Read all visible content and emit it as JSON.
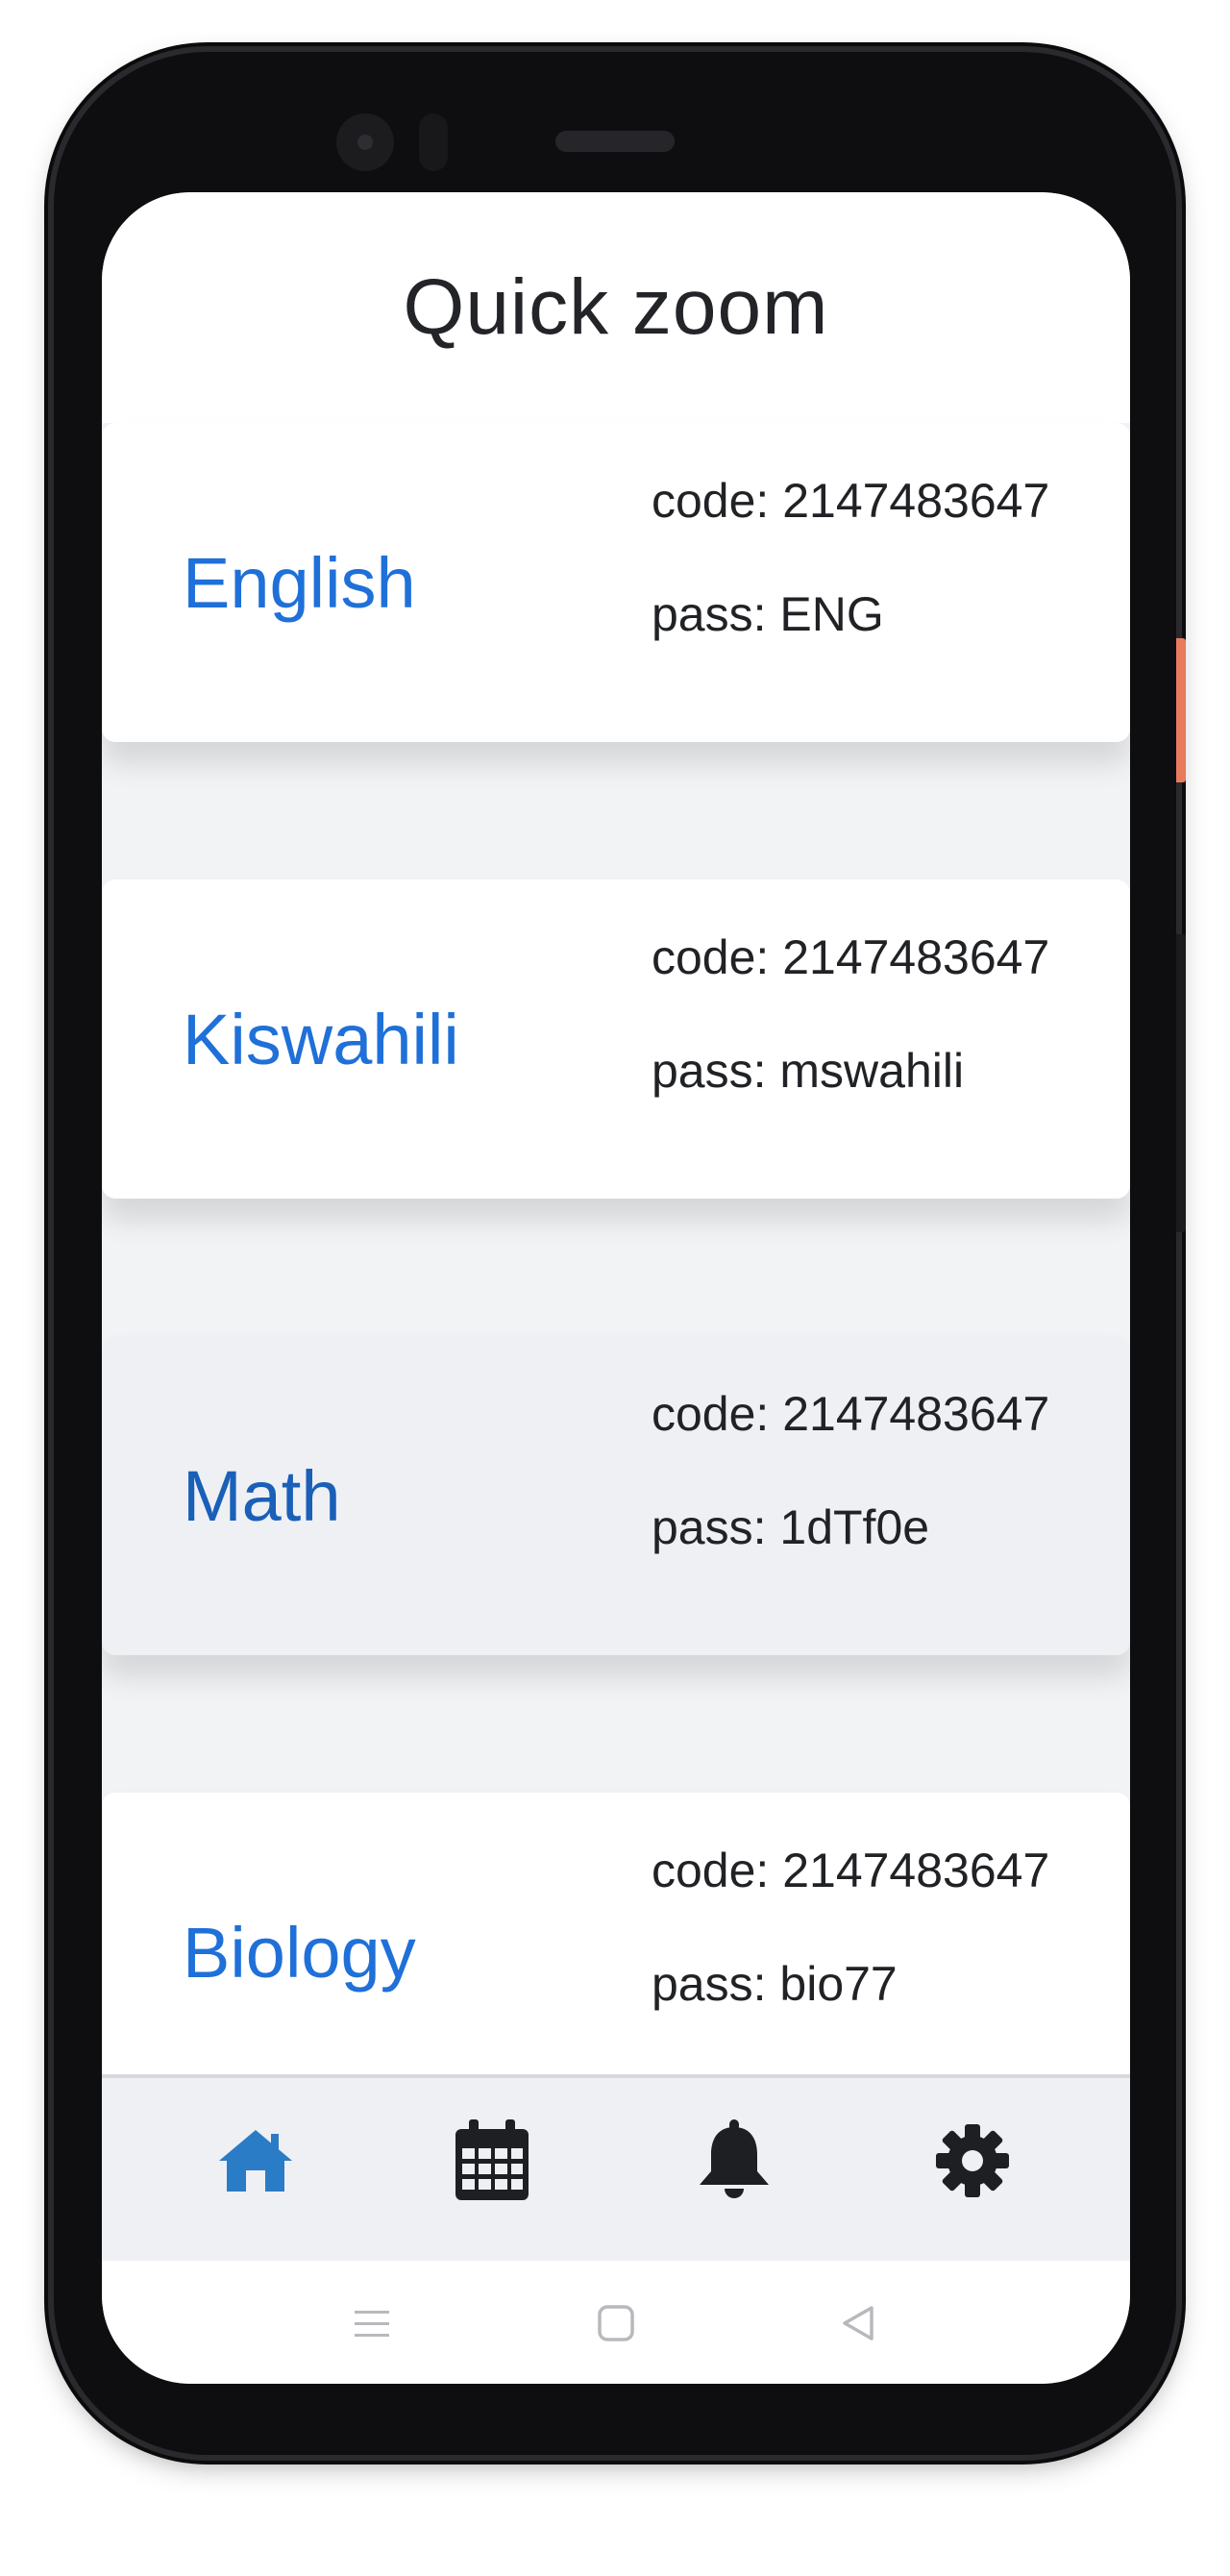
{
  "header": {
    "title": "Quick zoom"
  },
  "classes": [
    {
      "subject": "English",
      "code": "code: 2147483647",
      "pass": "pass: ENG"
    },
    {
      "subject": "Kiswahili",
      "code": "code: 2147483647",
      "pass": "pass: mswahili"
    },
    {
      "subject": "Math",
      "code": "code: 2147483647",
      "pass": "pass: 1dTf0e"
    },
    {
      "subject": "Biology",
      "code": "code: 2147483647",
      "pass": "pass: bio77"
    }
  ],
  "tabbar": {
    "tabs": [
      {
        "icon": "home-icon",
        "active": true
      },
      {
        "icon": "calendar-icon",
        "active": false
      },
      {
        "icon": "bell-icon",
        "active": false
      },
      {
        "icon": "gear-icon",
        "active": false
      }
    ]
  },
  "system_nav": {
    "buttons": [
      "menu-icon",
      "home-square-icon",
      "back-icon"
    ]
  },
  "colors": {
    "accent": "#1f70d8",
    "active_tab": "#2a7cc7",
    "inactive_tab": "#1e1f22",
    "background": "#f2f3f5"
  }
}
